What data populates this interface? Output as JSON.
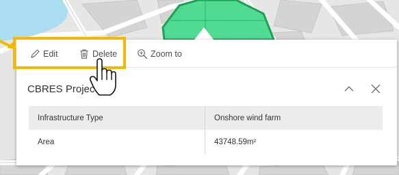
{
  "toolbar": {
    "edit_label": "Edit",
    "delete_label": "Delete",
    "zoom_label": "Zoom to"
  },
  "popup": {
    "title": "CBRES Project",
    "collapse_icon": "chevron-up-icon",
    "close_icon": "close-icon"
  },
  "attributes": [
    {
      "key": "Infrastructure Type",
      "value": "Onshore wind farm"
    },
    {
      "key": "Area",
      "value": "43748.59m²"
    }
  ],
  "colors": {
    "highlight": "#f5b800",
    "feature_fill": "#3fd888",
    "feature_outline": "#1f9f55"
  }
}
